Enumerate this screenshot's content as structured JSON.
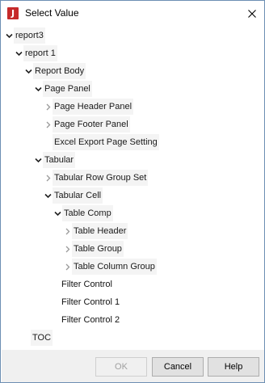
{
  "window": {
    "title": "Select Value",
    "app_icon_letter": "J"
  },
  "tree": {
    "items": [
      {
        "label": "report3",
        "expander": "expanded"
      },
      {
        "label": "report 1",
        "expander": "expanded"
      },
      {
        "label": "Report Body",
        "expander": "expanded"
      },
      {
        "label": "Page Panel",
        "expander": "expanded"
      },
      {
        "label": "Page Header Panel",
        "expander": "collapsed"
      },
      {
        "label": "Page Footer Panel",
        "expander": "collapsed"
      },
      {
        "label": "Excel Export Page Setting",
        "expander": "none"
      },
      {
        "label": "Tabular",
        "expander": "expanded"
      },
      {
        "label": "Tabular Row Group Set",
        "expander": "collapsed"
      },
      {
        "label": "Tabular Cell",
        "expander": "expanded"
      },
      {
        "label": "Table Comp",
        "expander": "expanded"
      },
      {
        "label": "Table Header",
        "expander": "collapsed"
      },
      {
        "label": "Table Group",
        "expander": "collapsed"
      },
      {
        "label": "Table Column Group",
        "expander": "collapsed"
      },
      {
        "label": "Filter Control",
        "expander": "none"
      },
      {
        "label": "Filter Control 1",
        "expander": "none"
      },
      {
        "label": "Filter Control 2",
        "expander": "none"
      },
      {
        "label": "TOC",
        "expander": "none"
      }
    ]
  },
  "buttons": {
    "ok": {
      "label": "OK",
      "enabled": false
    },
    "cancel": {
      "label": "Cancel",
      "enabled": true
    },
    "help": {
      "label": "Help",
      "enabled": true
    }
  },
  "icons": {
    "app": "jreport-icon",
    "close": "close-icon",
    "expanded": "chevron-down-icon",
    "collapsed": "chevron-right-icon"
  },
  "colors": {
    "app_icon": "#c62a2a",
    "window_border": "#6d8fb3",
    "label_background": "#f4f4f4",
    "footer_background": "#f0f0f0"
  }
}
